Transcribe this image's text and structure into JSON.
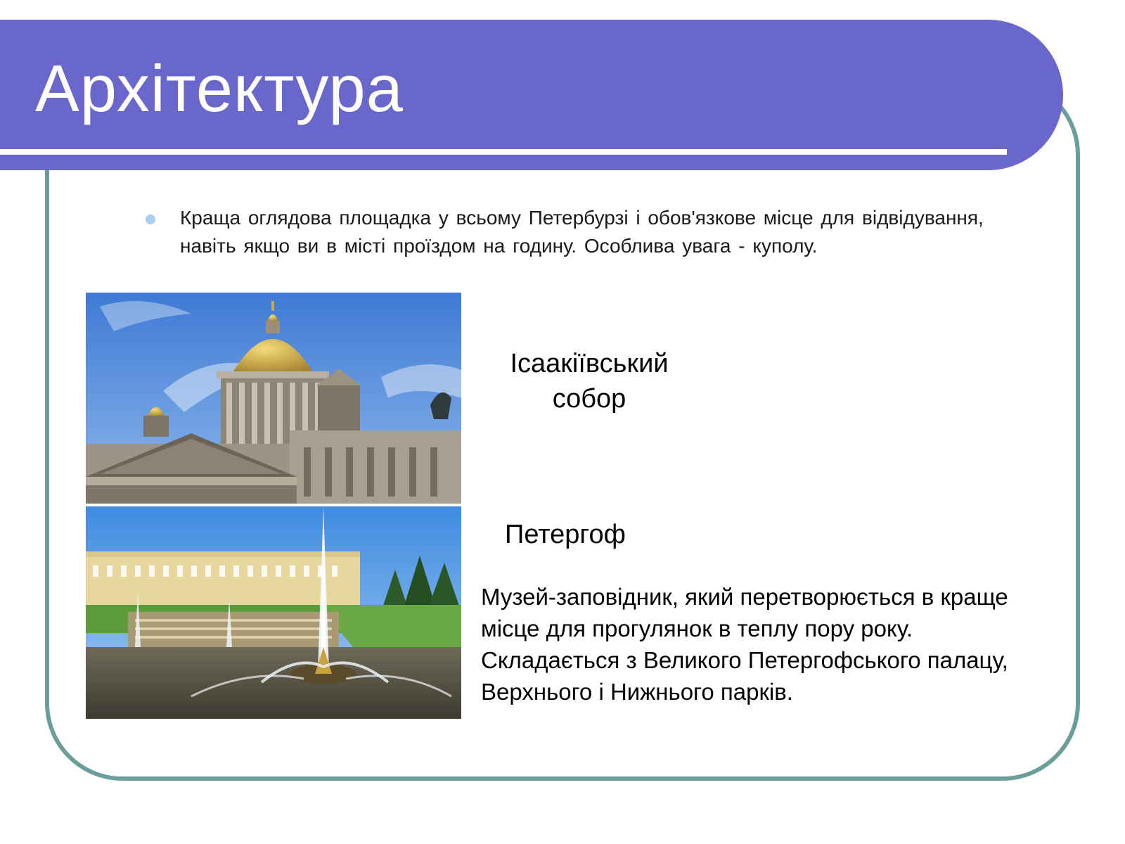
{
  "slide": {
    "title": "Архітектура",
    "bullet": "Краща оглядова площадка у всьому Петербурзі і обов'язкове місце для відвідування, навіть якщо ви в місті проїздом на годину. Особлива увага - куполу.",
    "images": {
      "isaac_photo": "isaac-cathedral-photo",
      "peterhof_photo": "peterhof-fountains-photo"
    },
    "isaac_caption": "Ісаакіївський собор",
    "peterhof_caption": "Петергоф",
    "peterhof_description": [
      "Музей-заповідник, який перетворюється в краще",
      "місце для прогулянок в теплу пору року.",
      "Складається з Великого Петергофського палацу,",
      "Верхнього і Нижнього парків."
    ]
  },
  "colors": {
    "title_band": "#6967cc",
    "frame_border": "#6a9e9c",
    "bullet_dot": "#a8cfee",
    "title_text": "#ffffff"
  }
}
